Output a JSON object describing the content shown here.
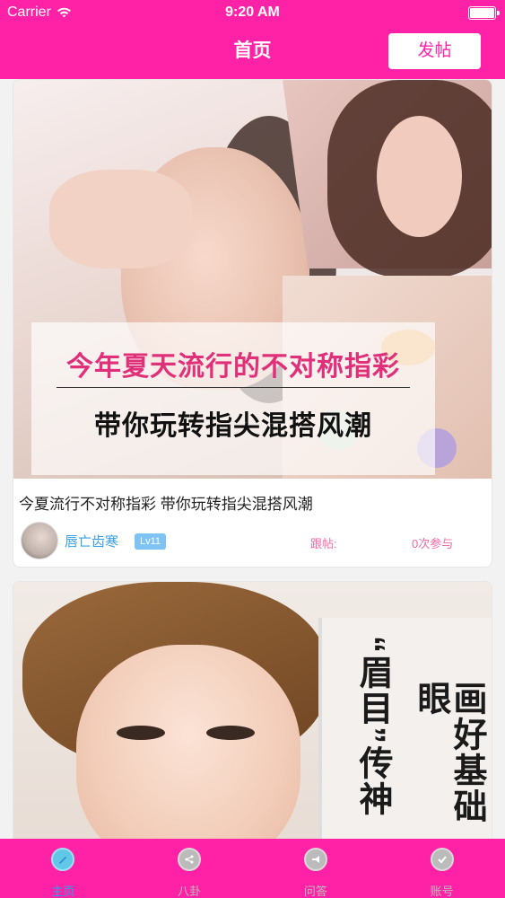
{
  "status_bar": {
    "carrier": "Carrier",
    "time": "9:20 AM"
  },
  "nav": {
    "title": "首页",
    "post_button": "发帖"
  },
  "posts": [
    {
      "banner_line1": "今年夏天流行的不对称指彩",
      "banner_line2": "带你玩转指尖混搭风潮",
      "title": "今夏流行不对称指彩 带你玩转指尖混搭风潮",
      "username": "唇亡齿寒",
      "level": "Lv11",
      "follow_label": "跟帖:",
      "participants": "0次参与"
    },
    {
      "image_text_1": "“眉目”传神",
      "image_text_2": "画好基础眼"
    }
  ],
  "tabs": [
    {
      "label": "主页",
      "icon": "home-icon",
      "active": true
    },
    {
      "label": "八卦",
      "icon": "share-icon",
      "active": false
    },
    {
      "label": "问答",
      "icon": "megaphone-icon",
      "active": false
    },
    {
      "label": "账号",
      "icon": "check-icon",
      "active": false
    }
  ],
  "colors": {
    "brand": "#ff22a6",
    "accent_blue": "#3aa0e6",
    "meta_pink": "#f06aa8"
  }
}
